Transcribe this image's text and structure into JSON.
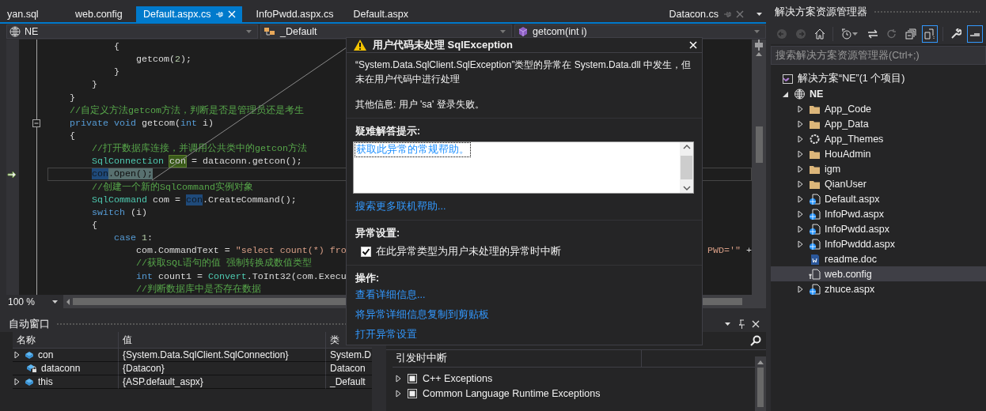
{
  "document_tabs": [
    {
      "label": "yan.sql",
      "selected": false,
      "pinned": false
    },
    {
      "label": "web.config",
      "selected": false,
      "pinned": false
    },
    {
      "label": "Default.aspx.cs",
      "selected": true,
      "pinned": false
    },
    {
      "label": "InfoPwdd.aspx.cs",
      "selected": false,
      "pinned": false
    },
    {
      "label": "Default.aspx",
      "selected": false,
      "pinned": false
    },
    {
      "label": "Datacon.cs",
      "selected": false,
      "pinned": true
    }
  ],
  "navigation_bar": [
    {
      "kind": "project",
      "label": "NE"
    },
    {
      "kind": "class",
      "label": "_Default"
    },
    {
      "kind": "method",
      "label": "getcom(int i)"
    }
  ],
  "editor": {
    "zoom": "100 %",
    "lines": [
      {
        "current": false,
        "tokens": [
          {
            "text": "            {",
            "kind": "plain"
          }
        ]
      },
      {
        "current": false,
        "tokens": [
          {
            "text": "                getcom(",
            "kind": "plain"
          },
          {
            "text": "2",
            "kind": "number"
          },
          {
            "text": ");",
            "kind": "plain"
          }
        ]
      },
      {
        "current": false,
        "tokens": [
          {
            "text": "            }",
            "kind": "plain"
          }
        ]
      },
      {
        "current": false,
        "tokens": [
          {
            "text": "        }",
            "kind": "plain"
          }
        ]
      },
      {
        "current": false,
        "tokens": [
          {
            "text": "    }",
            "kind": "plain"
          }
        ]
      },
      {
        "current": false,
        "tokens": [
          {
            "text": "    //自定义方法getcom方法，判断是否是管理员还是考生",
            "kind": "comment"
          }
        ]
      },
      {
        "current": false,
        "collapse": true,
        "tokens": [
          {
            "text": "    private ",
            "kind": "keyword"
          },
          {
            "text": "void",
            "kind": "keyword"
          },
          {
            "text": " getcom(",
            "kind": "plain"
          },
          {
            "text": "int",
            "kind": "keyword"
          },
          {
            "text": " i)",
            "kind": "plain"
          }
        ]
      },
      {
        "current": false,
        "tokens": [
          {
            "text": "    {",
            "kind": "plain"
          }
        ]
      },
      {
        "current": false,
        "tokens": [
          {
            "text": "        //打开数据库连接，并调用公共类中的getcon方法",
            "kind": "comment"
          }
        ]
      },
      {
        "current": false,
        "tokens": [
          {
            "text": "        SqlConnection ",
            "kind": "type"
          },
          {
            "text": "con",
            "kind": "write-ref"
          },
          {
            "text": " = dataconn.getcon();",
            "kind": "plain"
          }
        ]
      },
      {
        "current": true,
        "tokens": [
          {
            "text": "        con",
            "kind": "read-ref"
          },
          {
            "text": ".Open();",
            "kind": "plain"
          }
        ]
      },
      {
        "current": false,
        "tokens": [
          {
            "text": "        //创建一个新的SqlCommand实例对象",
            "kind": "comment"
          }
        ]
      },
      {
        "current": false,
        "tokens": [
          {
            "text": "        SqlCommand",
            "kind": "type"
          },
          {
            "text": " com = ",
            "kind": "plain"
          },
          {
            "text": "con",
            "kind": "read-ref"
          },
          {
            "text": ".CreateCommand();",
            "kind": "plain"
          }
        ]
      },
      {
        "current": false,
        "tokens": [
          {
            "text": "        switch",
            "kind": "keyword"
          },
          {
            "text": " (i)",
            "kind": "plain"
          }
        ]
      },
      {
        "current": false,
        "tokens": [
          {
            "text": "        {",
            "kind": "plain"
          }
        ]
      },
      {
        "current": false,
        "tokens": [
          {
            "text": "            case ",
            "kind": "keyword"
          },
          {
            "text": "1",
            "kind": "number"
          },
          {
            "text": ":",
            "kind": "plain"
          }
        ]
      },
      {
        "current": false,
        "tokens": [
          {
            "text": "                com.CommandText = ",
            "kind": "plain"
          },
          {
            "text": "\"select count(*) fro",
            "kind": "string"
          }
        ],
        "tail": [
          {
            "text": "PWD='\"",
            "kind": "string"
          },
          {
            "text": " +",
            "kind": "plain"
          }
        ]
      },
      {
        "current": false,
        "tokens": [
          {
            "text": "                //获取SQL语句的值 强制转换成数值类型",
            "kind": "comment"
          }
        ]
      },
      {
        "current": false,
        "tokens": [
          {
            "text": "                int",
            "kind": "keyword"
          },
          {
            "text": " count1 = ",
            "kind": "plain"
          },
          {
            "text": "Convert",
            "kind": "type"
          },
          {
            "text": ".ToInt32(com.Execu",
            "kind": "plain"
          }
        ]
      },
      {
        "current": false,
        "tokens": [
          {
            "text": "                //判断数据库中是否存在数据",
            "kind": "comment"
          }
        ]
      }
    ]
  },
  "autos": {
    "title": "自动窗口",
    "columns": [
      "名称",
      "值",
      "类"
    ],
    "rows": [
      {
        "name": "con",
        "value": "{System.Data.SqlClient.SqlConnection}",
        "type": "System.D",
        "kind": "field",
        "expanded": false
      },
      {
        "name": "dataconn",
        "value": "{Datacon}",
        "type": "Datacon",
        "kind": "private-field"
      },
      {
        "name": "this",
        "value": "{ASP.default_aspx}",
        "type": "_Default",
        "kind": "field",
        "expanded": false
      }
    ]
  },
  "exception_settings": {
    "columns": [
      "引发时中断"
    ],
    "rows": [
      {
        "label": "C++ Exceptions",
        "expanded": false,
        "indeterminate": true
      },
      {
        "label": "Common Language Runtime Exceptions",
        "expanded": false,
        "indeterminate": true
      }
    ]
  },
  "exception_popup": {
    "title": "用户代码未处理 SqlException",
    "message": "“System.Data.SqlClient.SqlException”类型的异常在 System.Data.dll 中发生，但未在用户代码中进行处理",
    "additional_info": "其他信息: 用户 'sa' 登录失败。",
    "tips_heading": "疑难解答提示:",
    "tips": [
      "获取此异常的常规帮助。"
    ],
    "search_link": "搜索更多联机帮助...",
    "settings_heading": "异常设置:",
    "break_checkbox": {
      "label": "在此异常类型为用户未处理的异常时中断",
      "checked": true
    },
    "actions_heading": "操作:",
    "actions": [
      "查看详细信息...",
      "将异常详细信息复制到剪贴板",
      "打开异常设置"
    ]
  },
  "solution_explorer": {
    "title": "解决方案资源管理器",
    "toolbar": [
      {
        "kind": "back",
        "on": false,
        "disabled": true
      },
      {
        "kind": "forward",
        "on": false,
        "disabled": true
      },
      {
        "kind": "home",
        "on": false,
        "disabled": false
      },
      {
        "kind": "history",
        "on": false,
        "disabled": false
      },
      {
        "kind": "sync",
        "on": false,
        "disabled": false
      },
      {
        "kind": "refresh",
        "on": false,
        "disabled": true
      },
      {
        "kind": "collapse",
        "on": false,
        "disabled": false
      },
      {
        "kind": "show-all",
        "on": true,
        "disabled": false
      },
      {
        "kind": "properties",
        "on": false,
        "disabled": false
      },
      {
        "kind": "preview",
        "on": true,
        "disabled": false
      }
    ],
    "search": {
      "placeholder": "搜索解决方案资源管理器(Ctrl+;)"
    },
    "tree": [
      {
        "label": "解决方案“NE”(1 个项目)",
        "kind": "solution",
        "selected": false,
        "children": [
          {
            "label": "NE",
            "kind": "project",
            "selected": false,
            "expanded": true,
            "children": [
              {
                "label": "App_Code",
                "kind": "folder",
                "selected": false,
                "expanded": false
              },
              {
                "label": "App_Data",
                "kind": "folder",
                "selected": false,
                "expanded": false
              },
              {
                "label": "App_Themes",
                "kind": "theme",
                "selected": false,
                "expanded": false
              },
              {
                "label": "HouAdmin",
                "kind": "folder",
                "selected": false,
                "expanded": false
              },
              {
                "label": "igm",
                "kind": "folder",
                "selected": false,
                "expanded": false
              },
              {
                "label": "QianUser",
                "kind": "folder",
                "selected": false,
                "expanded": false
              },
              {
                "label": "Default.aspx",
                "kind": "page",
                "selected": false,
                "expanded": false
              },
              {
                "label": "InfoPwd.aspx",
                "kind": "page",
                "selected": false,
                "expanded": false
              },
              {
                "label": "InfoPwdd.aspx",
                "kind": "page",
                "selected": false,
                "expanded": false
              },
              {
                "label": "InfoPwddd.aspx",
                "kind": "page",
                "selected": false,
                "expanded": false
              },
              {
                "label": "readme.doc",
                "kind": "doc",
                "selected": false
              },
              {
                "label": "web.config",
                "kind": "config",
                "selected": true
              },
              {
                "label": "zhuce.aspx",
                "kind": "page",
                "selected": false,
                "expanded": false
              }
            ]
          }
        ]
      }
    ]
  }
}
